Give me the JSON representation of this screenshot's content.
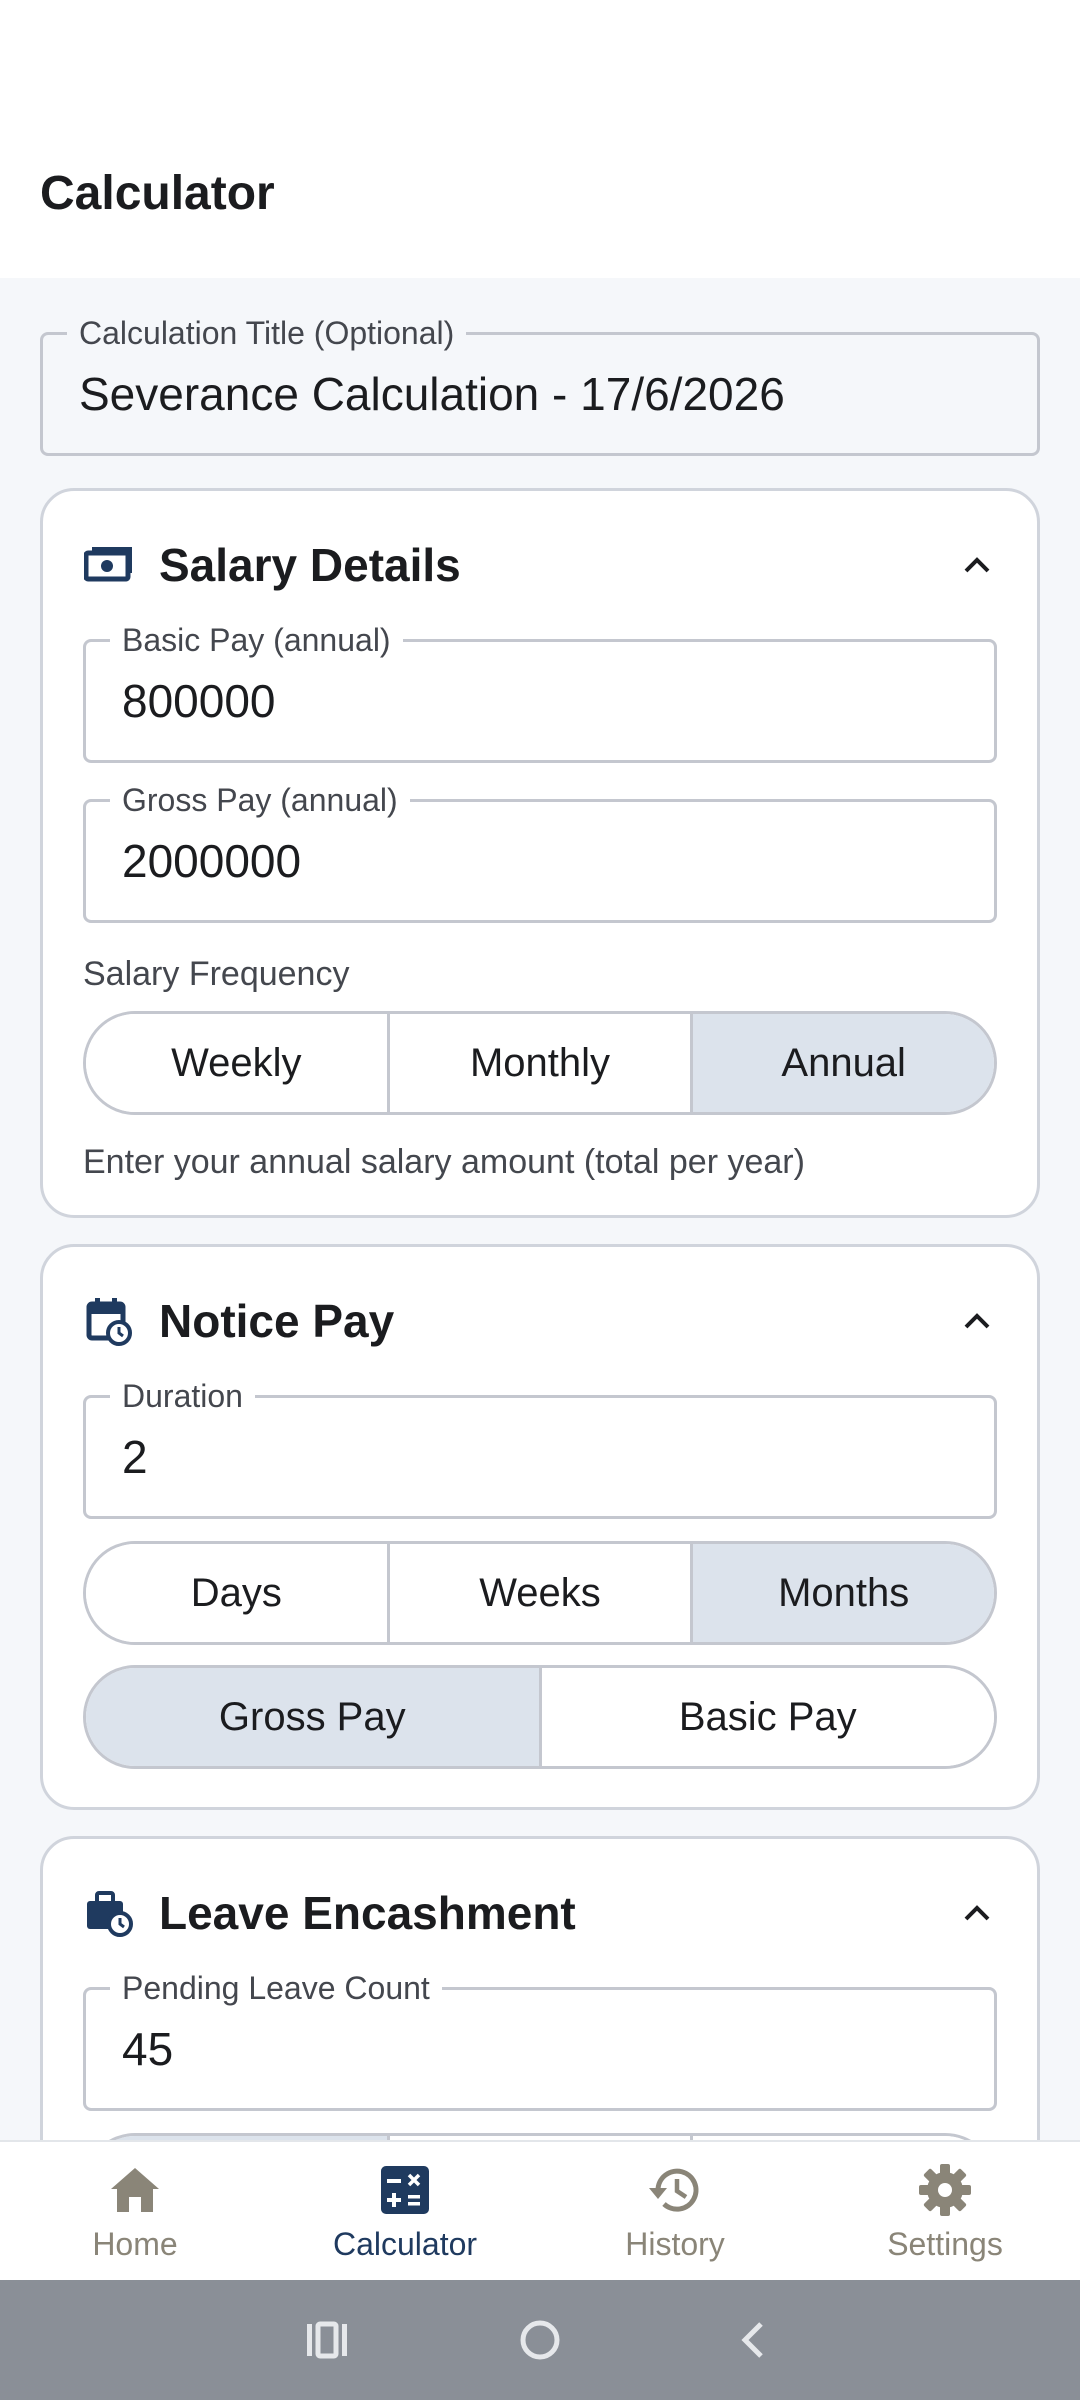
{
  "appbar": {
    "title": "Calculator"
  },
  "title_field": {
    "label": "Calculation Title (Optional)",
    "value": "Severance Calculation - 17/6/2026"
  },
  "salary": {
    "title": "Salary Details",
    "basic": {
      "label": "Basic Pay (annual)",
      "value": "800000"
    },
    "gross": {
      "label": "Gross Pay (annual)",
      "value": "2000000"
    },
    "frequency_label": "Salary Frequency",
    "frequency_options": [
      "Weekly",
      "Monthly",
      "Annual"
    ],
    "frequency_selected": "Annual",
    "helper": "Enter your annual salary amount (total per year)"
  },
  "notice": {
    "title": "Notice Pay",
    "duration": {
      "label": "Duration",
      "value": "2"
    },
    "unit_options": [
      "Days",
      "Weeks",
      "Months"
    ],
    "unit_selected": "Months",
    "pay_options": [
      "Gross Pay",
      "Basic Pay"
    ],
    "pay_selected": "Gross Pay"
  },
  "leave": {
    "title": "Leave Encashment",
    "pending": {
      "label": "Pending Leave Count",
      "value": "45"
    }
  },
  "nav": {
    "items": [
      {
        "label": "Home",
        "icon": "home-icon"
      },
      {
        "label": "Calculator",
        "icon": "calculator-icon"
      },
      {
        "label": "History",
        "icon": "history-icon"
      },
      {
        "label": "Settings",
        "icon": "gear-icon"
      }
    ],
    "active": "Calculator"
  },
  "colors": {
    "accent": "#1f3a5f",
    "inactive": "#8a8578",
    "selected_segment": "#dce3ec"
  }
}
